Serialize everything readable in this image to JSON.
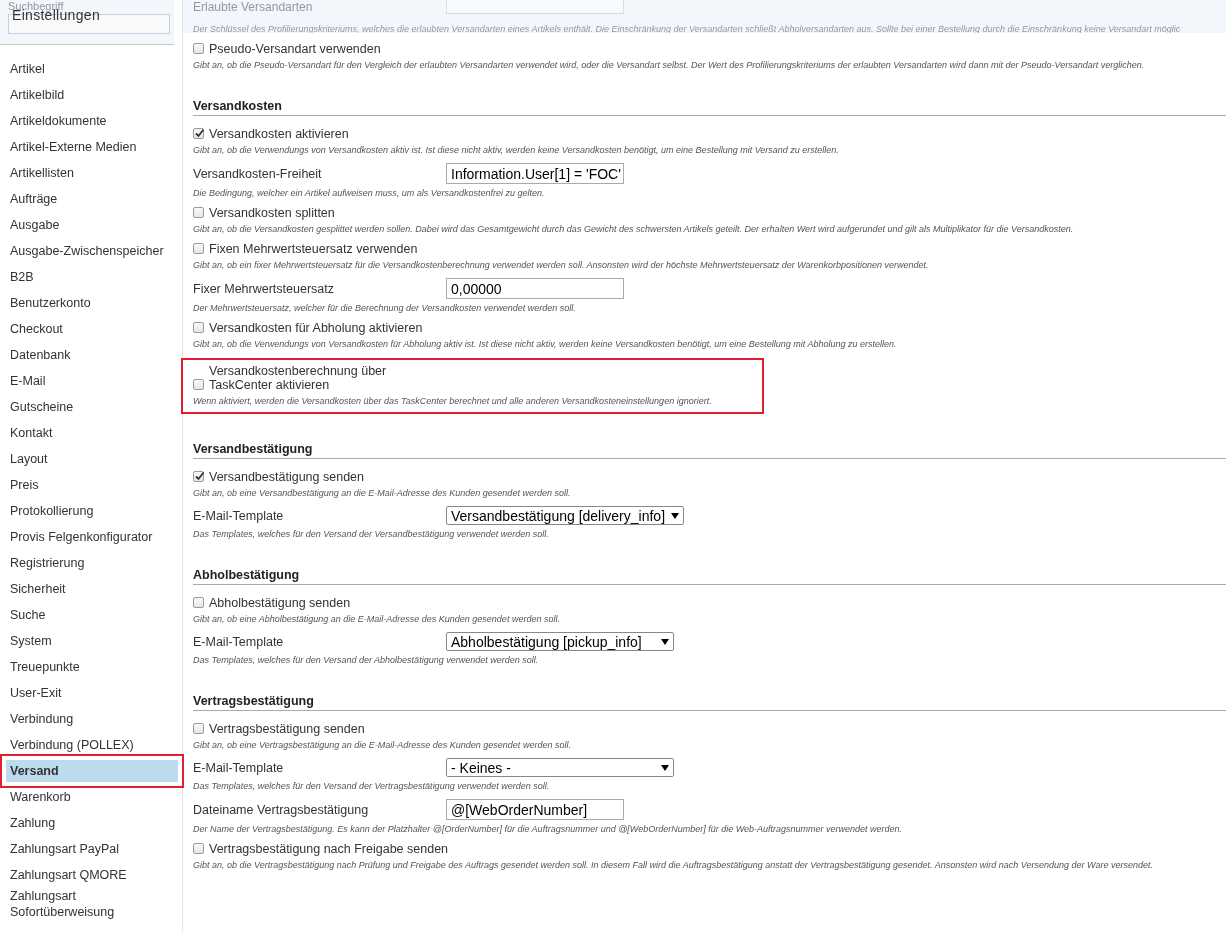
{
  "sidebar": {
    "search_label": "Suchbegriff",
    "title": "Einstellungen",
    "items": [
      {
        "label": "Artikel",
        "selected": false,
        "highlighted": false
      },
      {
        "label": "Artikelbild",
        "selected": false,
        "highlighted": false
      },
      {
        "label": "Artikeldokumente",
        "selected": false,
        "highlighted": false
      },
      {
        "label": "Artikel-Externe Medien",
        "selected": false,
        "highlighted": false
      },
      {
        "label": "Artikellisten",
        "selected": false,
        "highlighted": false
      },
      {
        "label": "Aufträge",
        "selected": false,
        "highlighted": false
      },
      {
        "label": "Ausgabe",
        "selected": false,
        "highlighted": false
      },
      {
        "label": "Ausgabe-Zwischenspeicher",
        "selected": false,
        "highlighted": false
      },
      {
        "label": "B2B",
        "selected": false,
        "highlighted": false
      },
      {
        "label": "Benutzerkonto",
        "selected": false,
        "highlighted": false
      },
      {
        "label": "Checkout",
        "selected": false,
        "highlighted": false
      },
      {
        "label": "Datenbank",
        "selected": false,
        "highlighted": false
      },
      {
        "label": "E-Mail",
        "selected": false,
        "highlighted": false
      },
      {
        "label": "Gutscheine",
        "selected": false,
        "highlighted": false
      },
      {
        "label": "Kontakt",
        "selected": false,
        "highlighted": false
      },
      {
        "label": "Layout",
        "selected": false,
        "highlighted": false
      },
      {
        "label": "Preis",
        "selected": false,
        "highlighted": false
      },
      {
        "label": "Protokollierung",
        "selected": false,
        "highlighted": false
      },
      {
        "label": "Provis Felgenkonfigurator",
        "selected": false,
        "highlighted": false
      },
      {
        "label": "Registrierung",
        "selected": false,
        "highlighted": false
      },
      {
        "label": "Sicherheit",
        "selected": false,
        "highlighted": false
      },
      {
        "label": "Suche",
        "selected": false,
        "highlighted": false
      },
      {
        "label": "System",
        "selected": false,
        "highlighted": false
      },
      {
        "label": "Treuepunkte",
        "selected": false,
        "highlighted": false
      },
      {
        "label": "User-Exit",
        "selected": false,
        "highlighted": false
      },
      {
        "label": "Verbindung",
        "selected": false,
        "highlighted": false
      },
      {
        "label": "Verbindung (POLLEX)",
        "selected": false,
        "highlighted": false
      },
      {
        "label": "Versand",
        "selected": true,
        "highlighted": true
      },
      {
        "label": "Warenkorb",
        "selected": false,
        "highlighted": false
      },
      {
        "label": "Zahlung",
        "selected": false,
        "highlighted": false
      },
      {
        "label": "Zahlungsart PayPal",
        "selected": false,
        "highlighted": false
      },
      {
        "label": "Zahlungsart QMORE",
        "selected": false,
        "highlighted": false
      },
      {
        "label": "Zahlungsart Sofortüberweisung",
        "selected": false,
        "highlighted": false
      }
    ]
  },
  "top_setting": {
    "label": "Erlaubte Versandarten",
    "description": "Der Schlüssel des Profilierungskriteriums, welches die erlaubten Versandarten eines Artikels enthält. Die Einschränkung der Versandarten schließt Abholversandarten aus. Sollte bei einer Bestellung durch die Einschränkung keine Versandart möglic"
  },
  "sections": [
    {
      "settings": [
        {
          "kind": "checkbox",
          "label": "Pseudo-Versandart verwenden",
          "checked": false,
          "highlighted": false,
          "description": "Gibt an, ob die Pseudo-Versandart für den Vergleich der erlaubten Versandarten verwendet wird, oder die Versandart selbst. Der Wert des Profilierungskriteriums der erlaubten Versandarten wird dann mit der Pseudo-Versandart verglichen."
        }
      ]
    },
    {
      "heading": "Versandkosten",
      "settings": [
        {
          "kind": "checkbox",
          "label": "Versandkosten aktivieren",
          "checked": true,
          "highlighted": false,
          "description": "Gibt an, ob die Verwendungs von Versandkosten aktiv ist. Ist diese nicht aktiv, werden keine Versandkosten benötigt, um eine Bestellung mit Versand zu erstellen."
        },
        {
          "kind": "text",
          "label": "Versandkosten-Freiheit",
          "value": "Information.User[1] = 'FOC'",
          "highlighted": false,
          "description": "Die Bedingung, welcher ein Artikel aufweisen muss, um als Versandkostenfrei zu gelten."
        },
        {
          "kind": "checkbox",
          "label": "Versandkosten splitten",
          "checked": false,
          "highlighted": false,
          "description": "Gibt an, ob die Versandkosten gesplittet werden sollen. Dabei wird das Gesamtgewicht durch das Gewicht des schwersten Artikels geteilt. Der erhalten Wert wird aufgerundet und gilt als Multiplikator für die Versandkosten."
        },
        {
          "kind": "checkbox",
          "label": "Fixen Mehrwertsteuersatz verwenden",
          "checked": false,
          "highlighted": false,
          "description": "Gibt an, ob ein fixer Mehrwertsteuersatz für die Versandkostenberechnung verwendet werden soll. Ansonsten wird der höchste Mehrwertsteuersatz der Warenkorbpositionen verwendet."
        },
        {
          "kind": "text",
          "label": "Fixer Mehrwertsteuersatz",
          "value": "0,00000",
          "highlighted": false,
          "description": "Der Mehrwertsteuersatz, welcher für die Berechnung der Versandkosten verwendet werden soll."
        },
        {
          "kind": "checkbox",
          "label": "Versandkosten für Abholung aktivieren",
          "checked": false,
          "highlighted": false,
          "description": "Gibt an, ob die Verwendungs von Versandkosten für Abholung aktiv ist. Ist diese nicht aktiv, werden keine Versandkosten benötigt, um eine Bestellung mit Abholung zu erstellen."
        },
        {
          "kind": "checkbox",
          "label": "Versandkostenberechnung über TaskCenter aktivieren",
          "checked": false,
          "highlighted": true,
          "description": "Wenn aktiviert, werden die Versandkosten über das TaskCenter berechnet und alle anderen Versandkosteneinstellungen ignoriert."
        }
      ]
    },
    {
      "heading": "Versandbestätigung",
      "settings": [
        {
          "kind": "checkbox",
          "label": "Versandbestätigung senden",
          "checked": true,
          "highlighted": false,
          "description": "Gibt an, ob eine Versandbestätigung an die E-Mail-Adresse des Kunden gesendet werden soll."
        },
        {
          "kind": "select",
          "label": "E-Mail-Template",
          "value": "Versandbestätigung [delivery_info]",
          "highlighted": false,
          "description": "Das Templates, welches für den Versand der Versandbestätigung verwendet werden soll."
        }
      ]
    },
    {
      "heading": "Abholbestätigung",
      "settings": [
        {
          "kind": "checkbox",
          "label": "Abholbestätigung senden",
          "checked": false,
          "highlighted": false,
          "description": "Gibt an, ob eine Abholbestätigung an die E-Mail-Adresse des Kunden gesendet werden soll."
        },
        {
          "kind": "select",
          "label": "E-Mail-Template",
          "value": "Abholbestätigung [pickup_info]",
          "highlighted": false,
          "description": "Das Templates, welches für den Versand der Abholbestätigung verwendet werden soll."
        }
      ]
    },
    {
      "heading": "Vertragsbestätigung",
      "settings": [
        {
          "kind": "checkbox",
          "label": "Vertragsbestätigung senden",
          "checked": false,
          "highlighted": false,
          "description": "Gibt an, ob eine Vertragsbestätigung an die E-Mail-Adresse des Kunden gesendet werden soll."
        },
        {
          "kind": "select",
          "label": "E-Mail-Template",
          "value": "- Keines -",
          "highlighted": false,
          "description": "Das Templates, welches für den Versand der Vertragsbestätigung verwendet werden soll."
        },
        {
          "kind": "text",
          "label": "Dateiname Vertragsbestätigung",
          "value": "@[WebOrderNumber]",
          "highlighted": false,
          "description": "Der Name der Vertragsbestätigung. Es kann der Platzhalter @[OrderNumber] für die Auftragsnummer und @[WebOrderNumber] für die Web-Auftragsnummer verwendet werden."
        },
        {
          "kind": "checkbox",
          "label": "Vertragsbestätigung nach Freigabe senden",
          "checked": false,
          "highlighted": false,
          "description": "Gibt an, ob die Vertragsbestätigung nach Prüfung und Freigabe des Auftrags gesendet werden soll. In diesem Fall wird die Auftragsbestätigung anstatt der Vertragsbestätigung gesendet. Ansonsten wird nach Versendung der Ware versendet."
        }
      ]
    }
  ]
}
